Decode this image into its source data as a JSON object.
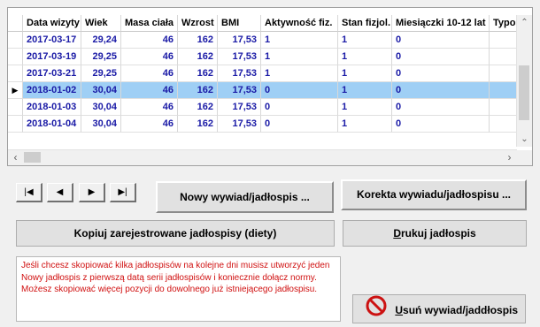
{
  "grid": {
    "columns": [
      "Data wizyty",
      "Wiek",
      "Masa ciała",
      "Wzrost",
      "BMI",
      "Aktywność fiz.",
      "Stan fizjol.",
      "Miesiączki 10-12 lat",
      "Typo"
    ],
    "rows": [
      {
        "date": "2017-03-17",
        "wiek": "29,24",
        "masa": "46",
        "wzrost": "162",
        "bmi": "17,53",
        "akt": "1",
        "stan": "1",
        "mies": "0",
        "typ": ""
      },
      {
        "date": "2017-03-19",
        "wiek": "29,25",
        "masa": "46",
        "wzrost": "162",
        "bmi": "17,53",
        "akt": "1",
        "stan": "1",
        "mies": "0",
        "typ": ""
      },
      {
        "date": "2017-03-21",
        "wiek": "29,25",
        "masa": "46",
        "wzrost": "162",
        "bmi": "17,53",
        "akt": "1",
        "stan": "1",
        "mies": "0",
        "typ": ""
      },
      {
        "date": "2018-01-02",
        "wiek": "30,04",
        "masa": "46",
        "wzrost": "162",
        "bmi": "17,53",
        "akt": "0",
        "stan": "1",
        "mies": "0",
        "typ": ""
      },
      {
        "date": "2018-01-03",
        "wiek": "30,04",
        "masa": "46",
        "wzrost": "162",
        "bmi": "17,53",
        "akt": "0",
        "stan": "1",
        "mies": "0",
        "typ": ""
      },
      {
        "date": "2018-01-04",
        "wiek": "30,04",
        "masa": "46",
        "wzrost": "162",
        "bmi": "17,53",
        "akt": "0",
        "stan": "1",
        "mies": "0",
        "typ": ""
      }
    ],
    "selected_indicator": "▶"
  },
  "nav": {
    "first": "|◀",
    "prev": "◀",
    "next": "▶",
    "last": "▶|"
  },
  "buttons": {
    "new_interview": "Nowy wywiad/jadłospis ...",
    "correct_interview": "Korekta wywiadu/jadłospisu ...",
    "copy_registered": "Kopiuj zarejestrowane jadłospisy (diety)",
    "print_prefix": "D",
    "print_rest": "rukuj jadłospis",
    "delete_prefix": "U",
    "delete_rest": "suń wywiad/jaddłospis"
  },
  "info": {
    "line1": "Jeśli chcesz skopiować kilka jadłospisów na kolejne dni musisz utworzyć jeden Nowy jadłospis z pierwszą datą serii jadłospisów i koniecznie dołącz normy.",
    "line2": "Możesz skopiować więcej pozycji do dowolnego już istniejącego jadłospisu."
  },
  "colors": {
    "selected_row": "#9fcff5",
    "data_text": "#1a1aa6",
    "warning_text": "#d01010",
    "no_icon": "#cc1111"
  },
  "icons": {
    "delete_icon": "no-entry-icon"
  }
}
